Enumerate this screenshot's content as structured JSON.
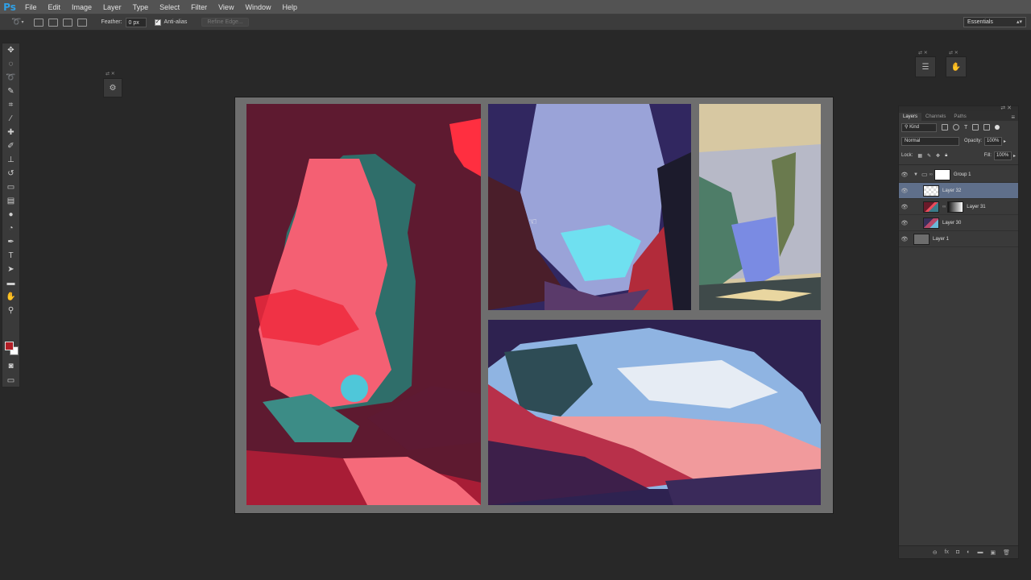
{
  "menubar": {
    "logo": "Ps",
    "items": [
      "File",
      "Edit",
      "Image",
      "Layer",
      "Type",
      "Select",
      "Filter",
      "View",
      "Window",
      "Help"
    ]
  },
  "options": {
    "feather_label": "Feather:",
    "feather_value": "0 px",
    "antialias_label": "Anti-alias",
    "refine_edge_label": "Refine Edge...",
    "workspace": "Essentials"
  },
  "colors": {
    "foreground": "#b21e26",
    "background": "#ffffff",
    "selection": "#5f6f8a"
  },
  "layers_panel": {
    "tabs": [
      "Layers",
      "Channels",
      "Paths"
    ],
    "active_tab": "Layers",
    "kind_filter": "Kind",
    "blend_mode": "Normal",
    "opacity_label": "Opacity:",
    "opacity_value": "100%",
    "lock_label": "Lock:",
    "fill_label": "Fill:",
    "fill_value": "100%",
    "layers": [
      {
        "name": "Group 1",
        "type": "group",
        "visible": true,
        "selected": false
      },
      {
        "name": "Layer 32",
        "type": "layer",
        "visible": true,
        "selected": true
      },
      {
        "name": "Layer 31",
        "type": "masked",
        "visible": true,
        "selected": false
      },
      {
        "name": "Layer 30",
        "type": "layer",
        "visible": true,
        "selected": false
      },
      {
        "name": "Layer 1",
        "type": "layer",
        "visible": true,
        "selected": false
      }
    ]
  }
}
